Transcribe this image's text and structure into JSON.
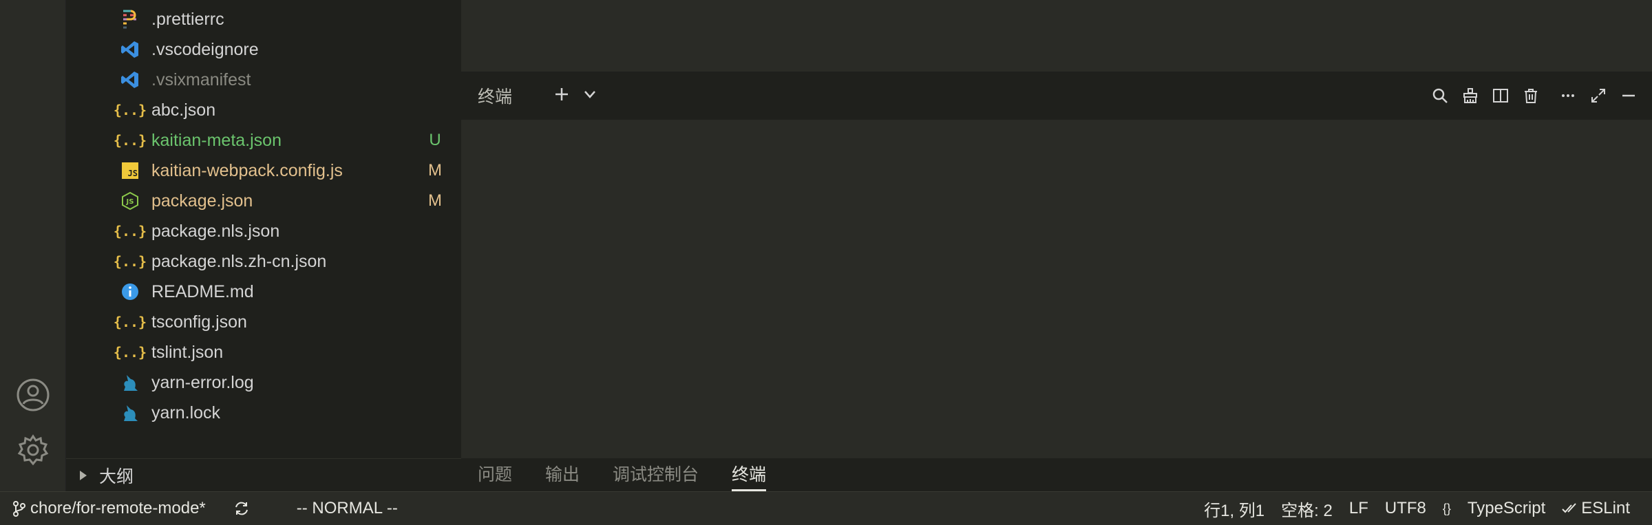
{
  "explorer": {
    "files": [
      {
        "name": ".prettierrc",
        "icon": "prettier-icon",
        "color": "#d4d4d4",
        "badge": "",
        "badge_color": ""
      },
      {
        "name": ".vscodeignore",
        "icon": "vscode-icon",
        "color": "#d4d4d4",
        "badge": "",
        "badge_color": ""
      },
      {
        "name": ".vsixmanifest",
        "icon": "vscode-icon",
        "color": "#8a8a82",
        "badge": "",
        "badge_color": ""
      },
      {
        "name": "abc.json",
        "icon": "json-icon",
        "color": "#d4d4d4",
        "badge": "",
        "badge_color": ""
      },
      {
        "name": "kaitian-meta.json",
        "icon": "json-icon",
        "color": "#6bc46d",
        "badge": "U",
        "badge_color": "#6bc46d"
      },
      {
        "name": "kaitian-webpack.config.js",
        "icon": "javascript-icon",
        "color": "#e2c08d",
        "badge": "M",
        "badge_color": "#e2c08d"
      },
      {
        "name": "package.json",
        "icon": "nodejs-icon",
        "color": "#e2c08d",
        "badge": "M",
        "badge_color": "#e2c08d"
      },
      {
        "name": "package.nls.json",
        "icon": "json-icon",
        "color": "#d4d4d4",
        "badge": "",
        "badge_color": ""
      },
      {
        "name": "package.nls.zh-cn.json",
        "icon": "json-icon",
        "color": "#d4d4d4",
        "badge": "",
        "badge_color": ""
      },
      {
        "name": "README.md",
        "icon": "info-icon",
        "color": "#d4d4d4",
        "badge": "",
        "badge_color": ""
      },
      {
        "name": "tsconfig.json",
        "icon": "json-icon",
        "color": "#d4d4d4",
        "badge": "",
        "badge_color": ""
      },
      {
        "name": "tslint.json",
        "icon": "json-icon",
        "color": "#d4d4d4",
        "badge": "",
        "badge_color": ""
      },
      {
        "name": "yarn-error.log",
        "icon": "yarn-icon",
        "color": "#d4d4d4",
        "badge": "",
        "badge_color": ""
      },
      {
        "name": "yarn.lock",
        "icon": "yarn-icon",
        "color": "#d4d4d4",
        "badge": "",
        "badge_color": ""
      }
    ],
    "outline_label": "大纲"
  },
  "terminal": {
    "title": "终端"
  },
  "panel_tabs": [
    "问题",
    "输出",
    "调试控制台",
    "终端"
  ],
  "active_panel_tab": "终端",
  "status": {
    "branch": "chore/for-remote-mode*",
    "vim_mode": "-- NORMAL --",
    "position": "行1, 列1",
    "indent": "空格: 2",
    "eol": "LF",
    "encoding": "UTF8",
    "braces": "{}",
    "language": "TypeScript",
    "linter": "ESLint"
  }
}
